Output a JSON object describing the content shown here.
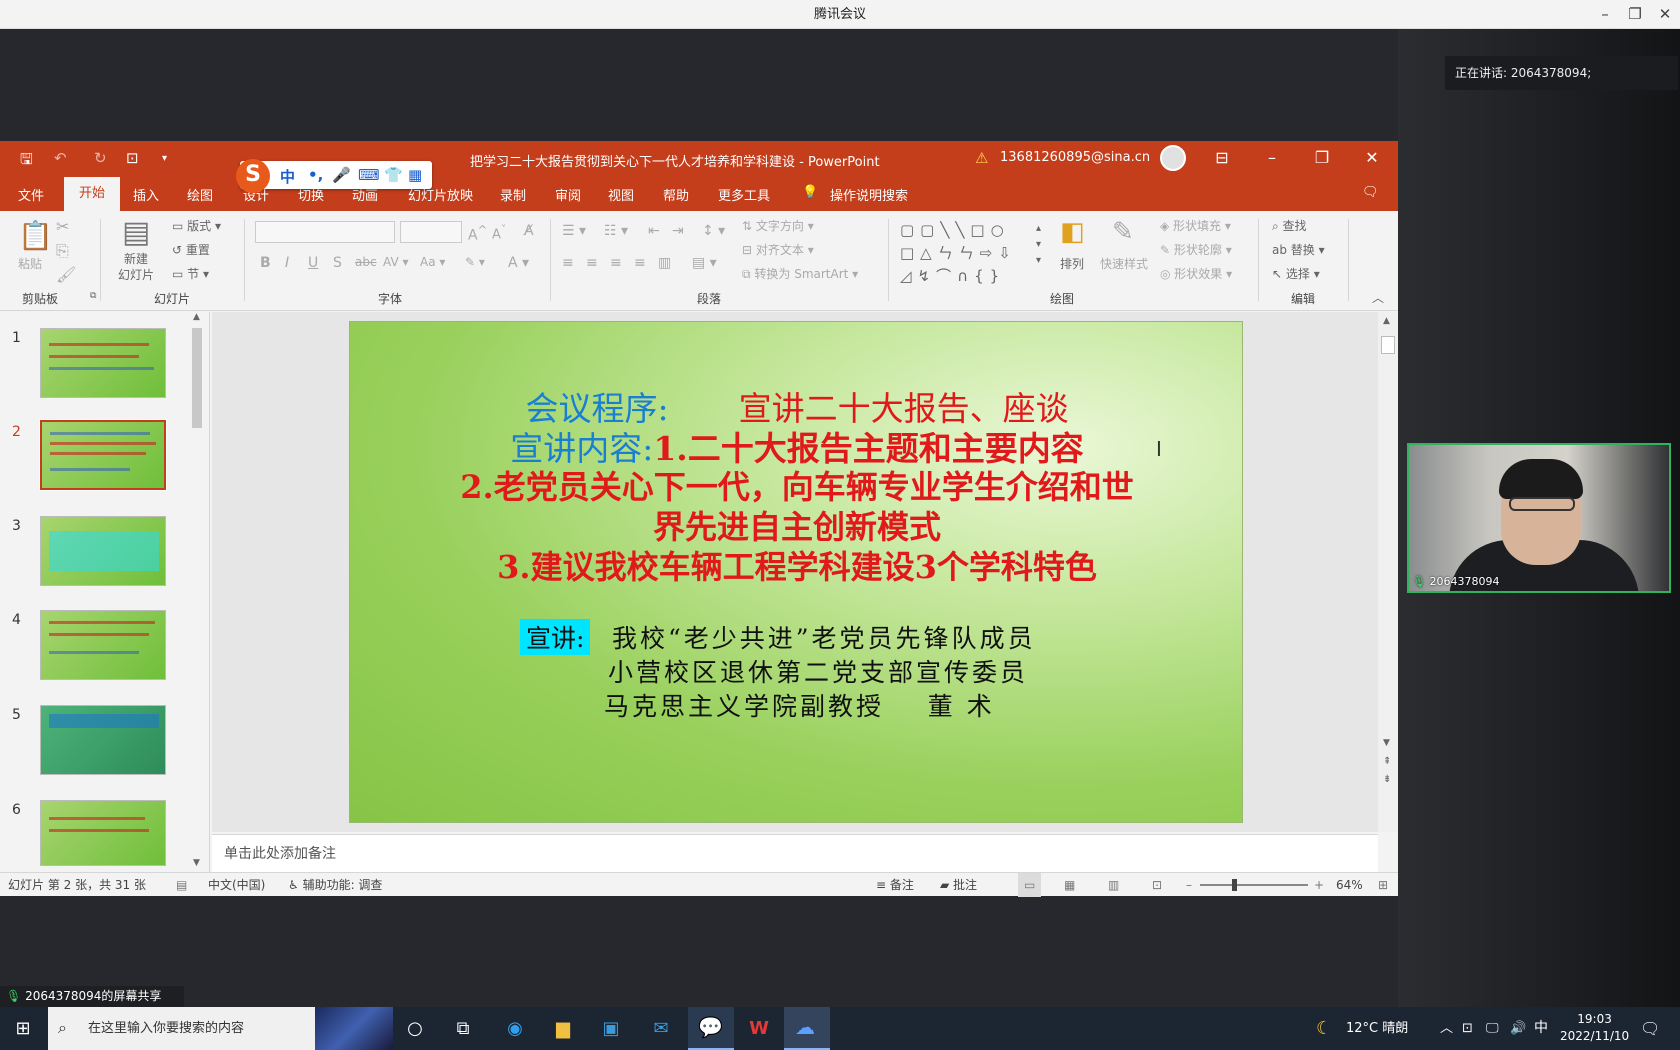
{
  "meeting": {
    "title": "腾讯会议",
    "speaking": "正在讲话: 2064378094;",
    "video_label": "2064378094",
    "share_label": "2064378094的屏幕共享"
  },
  "ppt": {
    "title": "把学习二十大报告贯彻到关心下一代人才培养和学科建设  -  PowerPoint",
    "warning_icon": "warning-icon",
    "user": "13681260895@sina.cn",
    "tabs": [
      "文件",
      "开始",
      "插入",
      "绘图",
      "设计",
      "切换",
      "动画",
      "幻灯片放映",
      "录制",
      "审阅",
      "视图",
      "帮助",
      "更多工具"
    ],
    "tell_me": "操作说明搜索",
    "groups": [
      "剪贴板",
      "幻灯片",
      "字体",
      "段落",
      "绘图",
      "编辑"
    ],
    "ribbon": {
      "paste": "粘贴",
      "new_slide": "新建\n幻灯片",
      "layout": "版式",
      "reset": "重置",
      "section": "节",
      "text_direction": "文字方向",
      "align_text": "对齐文本",
      "smartart": "转换为 SmartArt",
      "arrange": "排列",
      "quick_styles": "快速样式",
      "shape_fill": "形状填充",
      "shape_outline": "形状轮廓",
      "shape_effects": "形状效果",
      "find": "查找",
      "replace": "替换",
      "select": "选择"
    },
    "slide_numbers": [
      "1",
      "2",
      "3",
      "4",
      "5",
      "6"
    ],
    "slide": {
      "line1_label": "会议程序:",
      "line1_text": "宣讲二十大报告、座谈",
      "line2_label": "宣讲内容:",
      "line2_text": "1.二十大报告主题和主要内容",
      "line3": "2.老党员关心下一代，向车辆专业学生介绍和世",
      "line4": "界先进自主创新模式",
      "line5": "3.建议我校车辆工程学科建设3个学科特色",
      "speaker_label": "宣讲:",
      "speaker_1": "我校“老少共进”老党员先锋队成员",
      "speaker_2": "小营校区退休第二党支部宣传委员",
      "speaker_3": "马克思主义学院副教授    董 术"
    },
    "notes_placeholder": "单击此处添加备注",
    "status": {
      "slide_count": "幻灯片 第 2 张，共 31 张",
      "language": "中文(中国)",
      "accessibility": "辅助功能: 调查",
      "notes": "备注",
      "comments": "批注",
      "zoom": "64%"
    }
  },
  "taskbar": {
    "search_placeholder": "在这里输入你要搜索的内容",
    "weather": "12°C  晴朗",
    "ime": "中",
    "time": "19:03",
    "date": "2022/11/10"
  },
  "colors": {
    "ppt_red": "#c43e1c",
    "slide_blue": "#1b7fd1",
    "slide_red": "#e01a1a",
    "highlight_cyan": "#00e5ff"
  }
}
